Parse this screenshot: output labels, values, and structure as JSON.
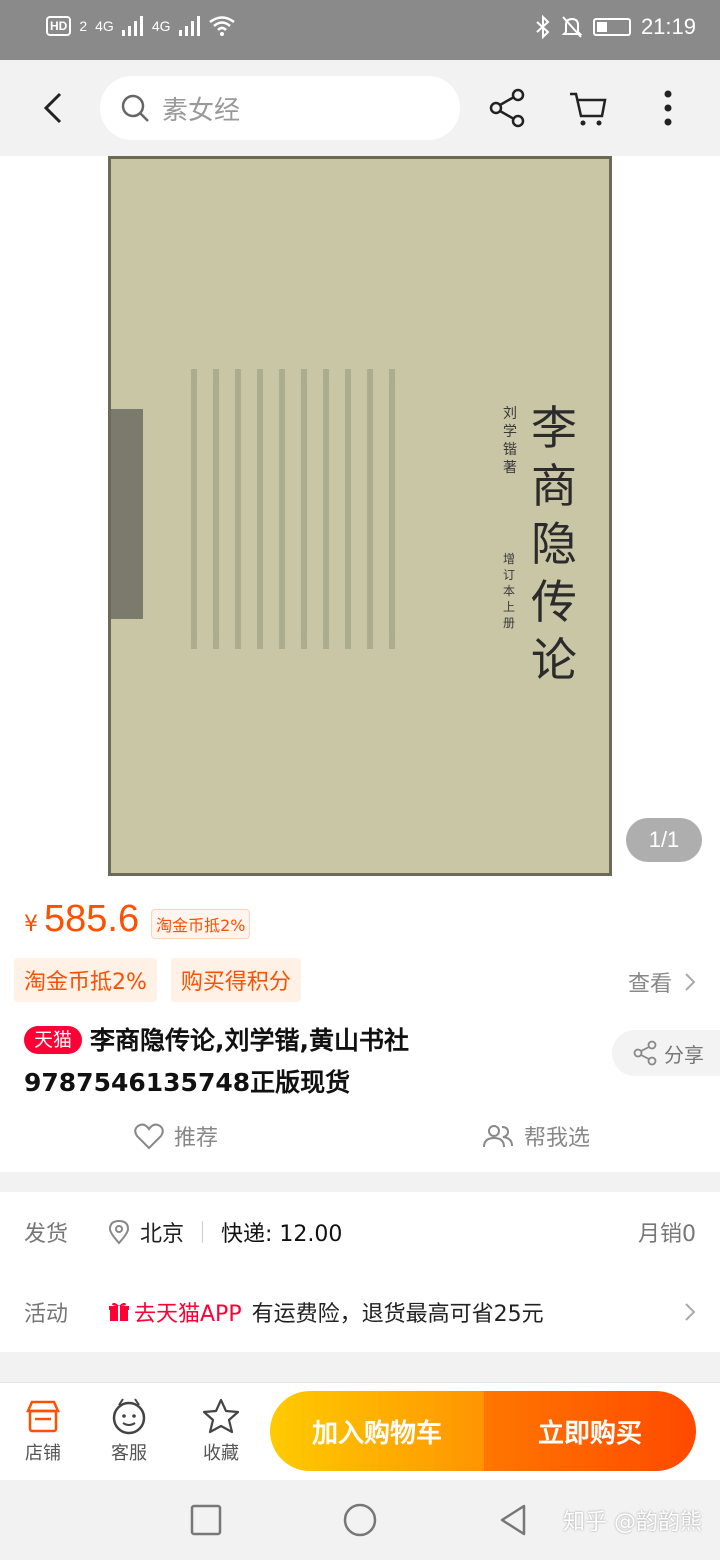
{
  "status_bar": {
    "hd": "HD",
    "sim": "2",
    "net1": "4G",
    "net2": "4G",
    "time": "21:19"
  },
  "nav": {
    "search_text": "素女经",
    "icons": [
      "back-icon",
      "share-icon",
      "cart-icon",
      "more-icon"
    ]
  },
  "gallery": {
    "cover_title": "李商隐传论",
    "cover_author": "刘学锴 著",
    "cover_edition": "增订本 上册",
    "counter": "1/1"
  },
  "product": {
    "currency": "¥",
    "price": "585.6",
    "price_tag": "淘金币抵2%",
    "promos": [
      "淘金币抵2%",
      "购买得积分"
    ],
    "view_more": "查看",
    "badge": "天猫",
    "title": "李商隐传论,刘学锴,黄山书社9787546135748正版现货",
    "share": "分享",
    "recommend": "推荐",
    "help_choose": "帮我选"
  },
  "shipping": {
    "label": "发货",
    "city": "北京",
    "express": "快递: 12.00",
    "monthly_sales": "月销0",
    "activity_label": "活动",
    "activity_link": "去天猫APP",
    "activity_text": "有运费险，退货最高可省25元"
  },
  "bottom_bar": {
    "shop": "店铺",
    "service": "客服",
    "favorite": "收藏",
    "add_to_cart": "加入购物车",
    "buy_now": "立即购买"
  },
  "watermark": "知乎 @韵韵熊",
  "colors": {
    "accent": "#ff5000",
    "tmall_red": "#ff0036",
    "cart_button": "#ffa800",
    "buy_button": "#ff5a00"
  }
}
